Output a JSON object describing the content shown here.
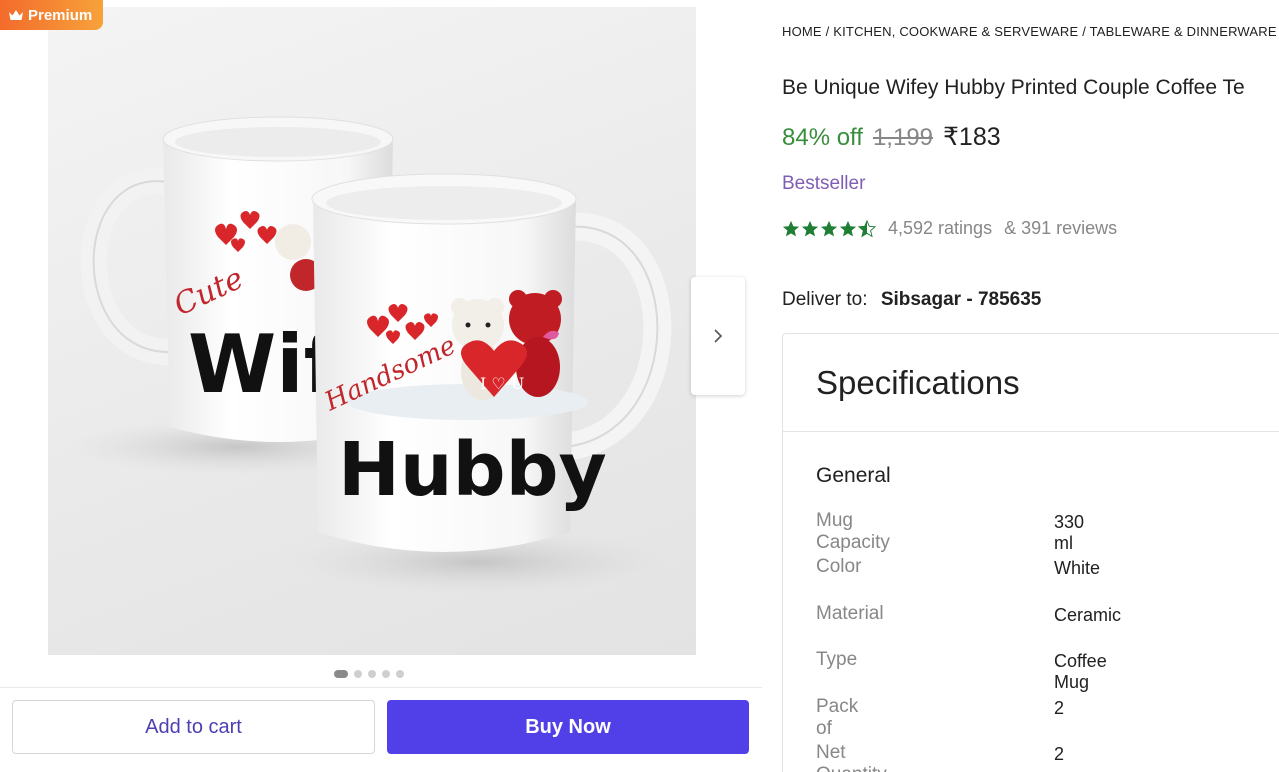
{
  "badge": {
    "label": "Premium",
    "icon": "crown-icon"
  },
  "gallery": {
    "image_texts": {
      "mug_back_script": "Cute",
      "mug_back_word": "Wif",
      "mug_front_script": "Handsome",
      "mug_front_word": "Hubby",
      "heart_text": "I ♡ U"
    },
    "dots_total": 5,
    "active_dot": 1
  },
  "actions": {
    "add_to_cart": "Add to cart",
    "buy_now": "Buy Now"
  },
  "breadcrumb": [
    "HOME",
    "KITCHEN, COOKWARE & SERVEWARE",
    "TABLEWARE & DINNERWARE",
    ""
  ],
  "product": {
    "title": "Be Unique Wifey Hubby Printed Couple Coffee Te",
    "discount": "84% off",
    "mrp": "1,199",
    "price": "₹183",
    "tag": "Bestseller",
    "rating_value": 4.5,
    "ratings": "4,592 ratings",
    "reviews": "& 391 reviews"
  },
  "delivery": {
    "label": "Deliver to:",
    "location": "Sibsagar - 785635"
  },
  "specs": {
    "heading": "Specifications",
    "group": "General",
    "rows": [
      {
        "key": "Mug Capacity",
        "value": "330 ml"
      },
      {
        "key": "Color",
        "value": "White"
      },
      {
        "key": "Material",
        "value": "Ceramic"
      },
      {
        "key": "Type",
        "value": "Coffee Mug"
      },
      {
        "key": "Pack of",
        "value": "2"
      },
      {
        "key": "Net Quantity",
        "value": "2"
      }
    ]
  },
  "colors": {
    "accent": "#5140e8",
    "discount": "#388e3c",
    "bestseller": "#7f5db5",
    "stars": "#1e7e34",
    "premium_start": "#f36b2c",
    "premium_end": "#f7a23a"
  }
}
